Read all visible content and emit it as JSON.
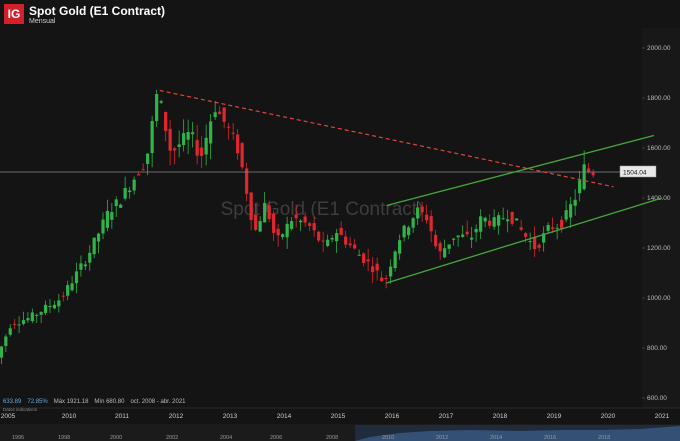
{
  "header": {
    "logo": "IG",
    "title": "Spot Gold (E1 Contract)",
    "subtitle": "Mensual"
  },
  "watermark": "Spot Gold (E1 Contract)",
  "price_label": "1504.04",
  "stats": {
    "low_val": "633.89",
    "pct": "72.85%",
    "max": "Máx 1921.18",
    "min": "Mín 680.80",
    "range": "oct. 2008 - abr. 2021"
  },
  "indicators_label": "Datos indicativos",
  "colors": {
    "up": "#2fb34a",
    "down": "#e0262f",
    "channel": "#45a53f",
    "trendline": "#e0463a",
    "price_line": "#8a8a8a"
  },
  "chart_data": {
    "type": "candlestick",
    "title": "Spot Gold (E1 Contract)",
    "timeframe": "Mensual",
    "ylim": [
      560,
      2080
    ],
    "y_ticks": [
      "600.00",
      "800.00",
      "1000.00",
      "1200.00",
      "1400.00",
      "1600.00",
      "1800.00",
      "2000.00"
    ],
    "y_tick_values": [
      600,
      800,
      1000,
      1200,
      1400,
      1600,
      1800,
      2000
    ],
    "x_ticks": [
      "2005",
      "2010",
      "2011",
      "2012",
      "2013",
      "2014",
      "2015",
      "2016",
      "2017",
      "2018",
      "2019",
      "2020",
      "2021"
    ],
    "navigator_ticks": [
      "1995",
      "1998",
      "2000",
      "2002",
      "2004",
      "2006",
      "2008",
      "2010",
      "2012",
      "2014",
      "2016",
      "2018"
    ],
    "current_price": 1504.04,
    "trendline_resistance": [
      {
        "t": 2011.7,
        "v": 1830
      },
      {
        "t": 2020.1,
        "v": 1445
      }
    ],
    "channel_upper": [
      {
        "t": 2015.9,
        "v": 1370
      },
      {
        "t": 2020.85,
        "v": 1650
      }
    ],
    "channel_lower": [
      {
        "t": 2015.9,
        "v": 1060
      },
      {
        "t": 2021.0,
        "v": 1400
      }
    ],
    "anchors": [
      [
        2008.6,
        720
      ],
      [
        2008.95,
        900
      ],
      [
        2009.3,
        920
      ],
      [
        2009.9,
        1000
      ],
      [
        2010.4,
        1170
      ],
      [
        2010.8,
        1350
      ],
      [
        2011.0,
        1390
      ],
      [
        2011.5,
        1560
      ],
      [
        2011.7,
        1830
      ],
      [
        2011.95,
        1580
      ],
      [
        2012.3,
        1660
      ],
      [
        2012.5,
        1560
      ],
      [
        2012.75,
        1770
      ],
      [
        2013.0,
        1680
      ],
      [
        2013.2,
        1590
      ],
      [
        2013.35,
        1430
      ],
      [
        2013.5,
        1260
      ],
      [
        2013.7,
        1380
      ],
      [
        2013.9,
        1220
      ],
      [
        2014.2,
        1320
      ],
      [
        2014.5,
        1290
      ],
      [
        2014.8,
        1200
      ],
      [
        2015.0,
        1270
      ],
      [
        2015.4,
        1180
      ],
      [
        2015.7,
        1120
      ],
      [
        2015.9,
        1060
      ],
      [
        2016.15,
        1230
      ],
      [
        2016.5,
        1350
      ],
      [
        2016.7,
        1320
      ],
      [
        2016.9,
        1170
      ],
      [
        2017.2,
        1250
      ],
      [
        2017.5,
        1240
      ],
      [
        2017.7,
        1320
      ],
      [
        2017.95,
        1300
      ],
      [
        2018.2,
        1340
      ],
      [
        2018.5,
        1250
      ],
      [
        2018.7,
        1200
      ],
      [
        2018.95,
        1280
      ],
      [
        2019.2,
        1300
      ],
      [
        2019.45,
        1410
      ],
      [
        2019.6,
        1520
      ],
      [
        2019.72,
        1504
      ]
    ]
  }
}
